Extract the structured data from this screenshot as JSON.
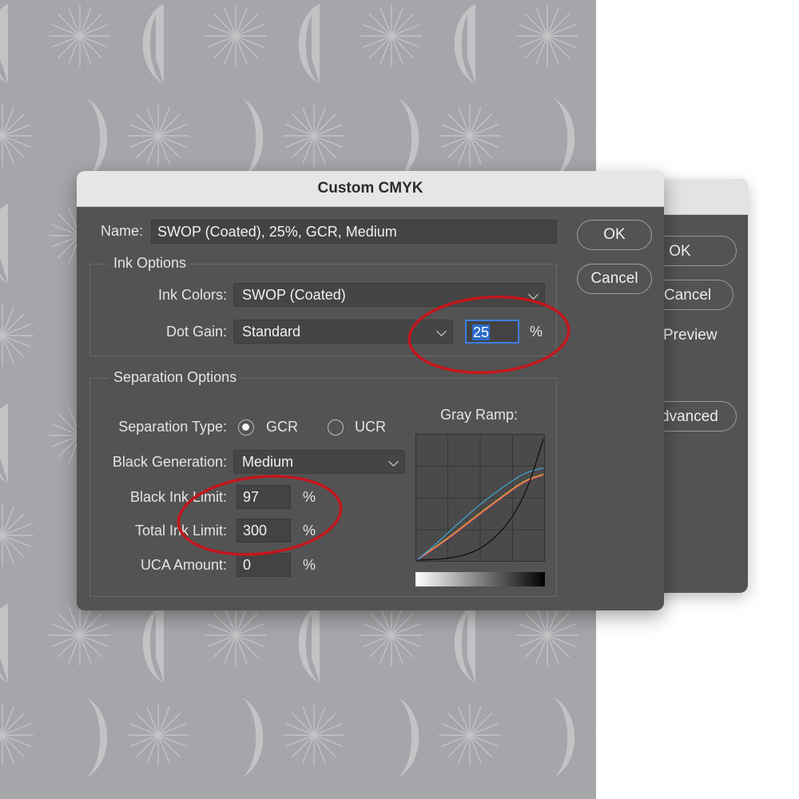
{
  "background_dialog": {
    "ok_label": "OK",
    "cancel_label": "Cancel",
    "preview_label": "Preview",
    "advanced_label": "dvanced"
  },
  "dialog": {
    "title": "Custom CMYK",
    "name_label": "Name:",
    "name_value": "SWOP (Coated), 25%, GCR, Medium",
    "ok_label": "OK",
    "cancel_label": "Cancel",
    "ink_options": {
      "legend": "Ink Options",
      "ink_colors_label": "Ink Colors:",
      "ink_colors_value": "SWOP (Coated)",
      "dot_gain_label": "Dot Gain:",
      "dot_gain_value": "Standard",
      "dot_gain_percent": "25",
      "percent_sign": "%"
    },
    "separation_options": {
      "legend": "Separation Options",
      "separation_type_label": "Separation Type:",
      "gcr_label": "GCR",
      "ucr_label": "UCR",
      "selected_type": "GCR",
      "black_generation_label": "Black Generation:",
      "black_generation_value": "Medium",
      "black_ink_limit_label": "Black Ink Limit:",
      "black_ink_limit_value": "97",
      "total_ink_limit_label": "Total Ink Limit:",
      "total_ink_limit_value": "300",
      "uca_amount_label": "UCA Amount:",
      "uca_amount_value": "0",
      "percent_sign": "%",
      "gray_ramp_label": "Gray Ramp:"
    }
  },
  "gray_ramp_curves": {
    "cyan": {
      "color": "#3fa9d6",
      "points": [
        [
          0,
          0
        ],
        [
          0.15,
          0.13
        ],
        [
          0.3,
          0.27
        ],
        [
          0.5,
          0.45
        ],
        [
          0.7,
          0.6
        ],
        [
          0.85,
          0.7
        ],
        [
          1,
          0.74
        ]
      ]
    },
    "magenta": {
      "color": "#e0506a",
      "points": [
        [
          0,
          0
        ],
        [
          0.15,
          0.1
        ],
        [
          0.3,
          0.21
        ],
        [
          0.5,
          0.37
        ],
        [
          0.7,
          0.52
        ],
        [
          0.85,
          0.63
        ],
        [
          1,
          0.68
        ]
      ]
    },
    "yellow": {
      "color": "#e8b030",
      "points": [
        [
          0,
          0
        ],
        [
          0.15,
          0.11
        ],
        [
          0.3,
          0.22
        ],
        [
          0.5,
          0.38
        ],
        [
          0.7,
          0.53
        ],
        [
          0.85,
          0.64
        ],
        [
          1,
          0.69
        ]
      ]
    },
    "black": {
      "color": "#101010",
      "points": [
        [
          0,
          0
        ],
        [
          0.25,
          0.01
        ],
        [
          0.45,
          0.06
        ],
        [
          0.6,
          0.16
        ],
        [
          0.75,
          0.33
        ],
        [
          0.88,
          0.58
        ],
        [
          1,
          0.97
        ]
      ]
    }
  },
  "colors": {
    "dialog_bg": "#535353",
    "highlight_ring": "#c4161c",
    "focus_blue": "#3f7de0",
    "canvas_gray": "#a6a6aa"
  }
}
